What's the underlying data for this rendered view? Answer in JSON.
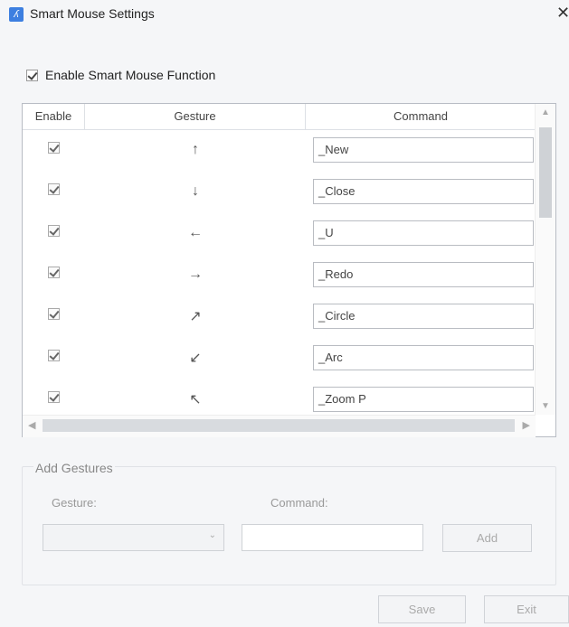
{
  "window": {
    "title": "Smart Mouse Settings",
    "close_glyph": "✕"
  },
  "enable_function": {
    "label": "Enable Smart Mouse Function",
    "checked": true
  },
  "grid": {
    "headers": {
      "enable": "Enable",
      "gesture": "Gesture",
      "command": "Command"
    },
    "rows": [
      {
        "enabled": true,
        "gesture": "↑",
        "command": "_New"
      },
      {
        "enabled": true,
        "gesture": "↓",
        "command": "_Close"
      },
      {
        "enabled": true,
        "gesture": "←",
        "command": "_U"
      },
      {
        "enabled": true,
        "gesture": "→",
        "command": "_Redo"
      },
      {
        "enabled": true,
        "gesture": "↗",
        "command": "_Circle"
      },
      {
        "enabled": true,
        "gesture": "↙",
        "command": "_Arc"
      },
      {
        "enabled": true,
        "gesture": "↖",
        "command": "_Zoom P"
      }
    ]
  },
  "add_gestures": {
    "title": "Add Gestures",
    "gesture_label": "Gesture:",
    "command_label": "Command:",
    "gesture_value": "",
    "command_value": "",
    "add_label": "Add"
  },
  "footer": {
    "save_label": "Save",
    "exit_label": "Exit"
  }
}
